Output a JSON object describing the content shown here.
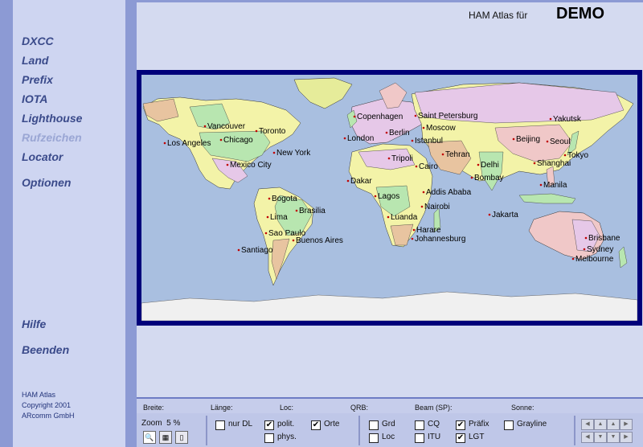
{
  "header": {
    "label": "HAM Atlas für",
    "user": "DEMO"
  },
  "nav": [
    {
      "label": "DXCC",
      "enabled": true
    },
    {
      "label": "Land",
      "enabled": true
    },
    {
      "label": "Prefix",
      "enabled": true
    },
    {
      "label": "IOTA",
      "enabled": true
    },
    {
      "label": "Lighthouse",
      "enabled": true
    },
    {
      "label": "Rufzeichen",
      "enabled": false
    },
    {
      "label": "Locator",
      "enabled": true
    },
    {
      "label": "Optionen",
      "enabled": true
    },
    {
      "label": "Hilfe",
      "enabled": true
    },
    {
      "label": "Beenden",
      "enabled": true
    }
  ],
  "copyright": [
    "HAM Atlas",
    "Copyright 2001",
    "ARcomm GmbH"
  ],
  "map": {
    "cities": [
      "Vancouver",
      "Toronto",
      "Chicago",
      "Los Angeles",
      "New York",
      "Mexico City",
      "Bogota",
      "Lima",
      "Brasilia",
      "Sao Paulo",
      "Santiago",
      "Buenos Aires",
      "Copenhagen",
      "Saint Petersburg",
      "Berlin",
      "Moscow",
      "London",
      "Istanbul",
      "Tehran",
      "Tripoli",
      "Cairo",
      "Dakar",
      "Lagos",
      "Addis Ababa",
      "Nairobi",
      "Luanda",
      "Harare",
      "Johannesburg",
      "Delhi",
      "Bombay",
      "Beijing",
      "Seoul",
      "Tokyo",
      "Shanghai",
      "Yakutsk",
      "Manila",
      "Jakarta",
      "Brisbane",
      "Sydney",
      "Melbourne"
    ],
    "colors": {
      "ocean": "#a9bfe0",
      "border": "#00007a",
      "ice": "#f0f0f0",
      "dot": "#c00000"
    }
  },
  "status": {
    "breite": "Breite:",
    "laenge": "Länge:",
    "loc": "Loc:",
    "qrb": "QRB:",
    "beam": "Beam (SP):",
    "sonne": "Sonne:"
  },
  "zoom": {
    "label": "Zoom",
    "value": "5 %"
  },
  "options": {
    "nur_dl": {
      "label": "nur DL",
      "checked": false
    },
    "polit": {
      "label": "polit.",
      "checked": true
    },
    "orte": {
      "label": "Orte",
      "checked": true
    },
    "phys": {
      "label": "phys.",
      "checked": false
    },
    "grd": {
      "label": "Grd",
      "checked": false
    },
    "cq": {
      "label": "CQ",
      "checked": false
    },
    "praefix": {
      "label": "Präfix",
      "checked": true
    },
    "grayline": {
      "label": "Grayline",
      "checked": false
    },
    "loc": {
      "label": "Loc",
      "checked": false
    },
    "itu": {
      "label": "ITU",
      "checked": false
    },
    "lgt": {
      "label": "LGT",
      "checked": true
    }
  }
}
